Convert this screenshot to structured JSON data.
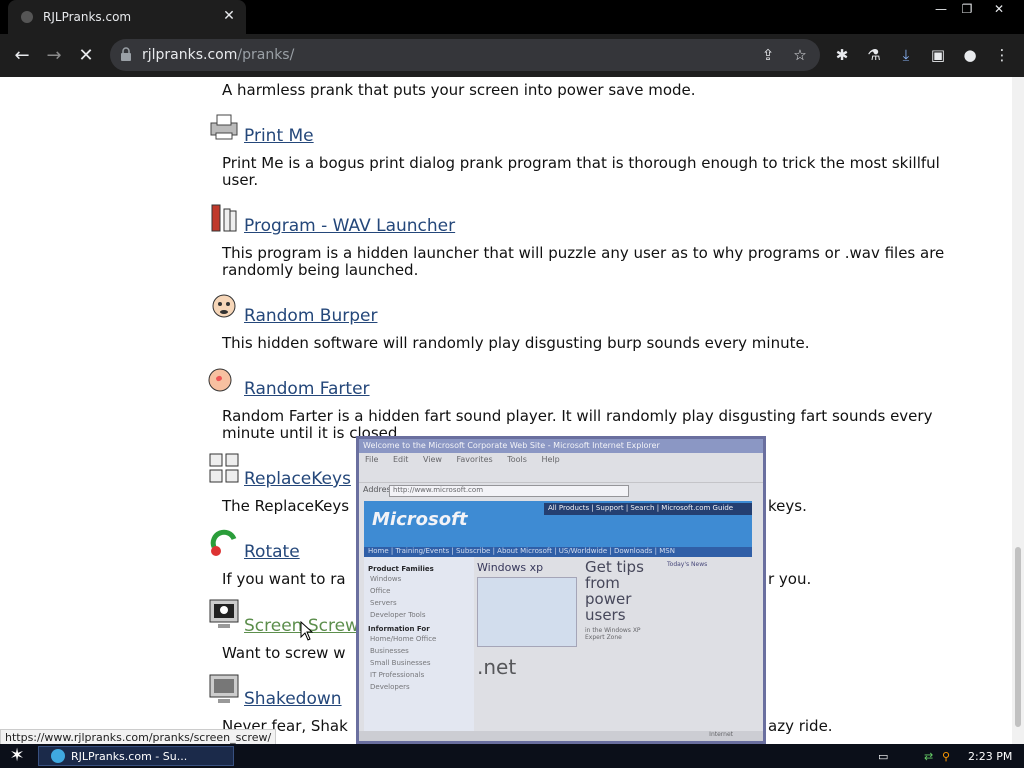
{
  "browser": {
    "tab_title": "RJLPranks.com",
    "tab_close": "✕",
    "url_host": "rjlpranks.com",
    "url_path": "/pranks/",
    "window_controls": [
      "—",
      "❐",
      "✕"
    ]
  },
  "page": {
    "top_desc": "A harmless prank that puts your screen into power save mode.",
    "pranks": [
      {
        "title": "Print Me",
        "desc": "Print Me is a bogus print dialog prank program that is thorough enough to trick the most skillful user."
      },
      {
        "title": "Program - WAV Launcher",
        "desc": "This program is a hidden launcher that will puzzle any user as to why programs or .wav files are randomly being launched."
      },
      {
        "title": "Random Burper",
        "desc": "This hidden software will randomly play disgusting burp sounds every minute."
      },
      {
        "title": "Random Farter",
        "desc": "Random Farter is a hidden fart sound player. It will randomly play disgusting fart sounds every minute until it is closed."
      },
      {
        "title": "ReplaceKeys",
        "desc": "The ReplaceKeys",
        "desc_tail": "keys."
      },
      {
        "title": "Rotate",
        "desc": "If you want to ra",
        "desc_tail": "r you."
      },
      {
        "title": "Screen Screw",
        "desc": "Want to screw w"
      },
      {
        "title": "Shakedown",
        "desc": "Never fear, Shak",
        "desc_tail": "azy ride."
      }
    ]
  },
  "status_url": "https://www.rjlpranks.com/pranks/screen_screw/",
  "overlay": {
    "title": "Welcome to the Microsoft Corporate Web Site - Microsoft Internet Explorer",
    "menu": [
      "File",
      "Edit",
      "View",
      "Favorites",
      "Tools",
      "Help"
    ],
    "address_label": "Address",
    "address": "http://www.microsoft.com",
    "logo": "Microsoft",
    "topnav": "All Products | Support | Search | Microsoft.com Guide",
    "nav2": "Home | Training/Events | Subscribe | About Microsoft | US/Worldwide | Downloads | MSN",
    "left_heading1": "Product Families",
    "left_items1": [
      "Windows",
      "Office",
      "Servers",
      "Developer Tools"
    ],
    "left_heading2": "Information For",
    "left_items2": [
      "Home/Home Office",
      "Businesses",
      "Small Businesses",
      "IT Professionals",
      "Developers"
    ],
    "windows_logo": "Windows xp",
    "get_tips": "Get tips from power users",
    "get_tips_sub": "in the Windows XP Expert Zone",
    "net": ".net",
    "right_heading": "Today's News",
    "status": "Internet"
  },
  "taskbar": {
    "task_label": "RJLPranks.com - Su...",
    "time": "2:23 PM"
  }
}
